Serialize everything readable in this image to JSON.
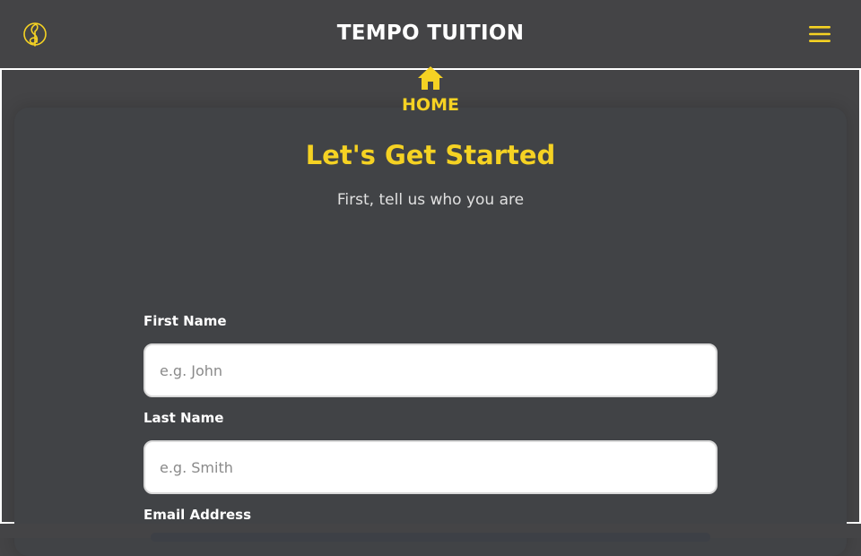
{
  "header": {
    "brand": "TEMPO TUITION",
    "logo_icon": "treble-clef-logo-icon",
    "menu_icon": "hamburger-menu-icon"
  },
  "colors": {
    "accent": "#f5d223",
    "background": "#444446",
    "card": "#414346"
  },
  "nav": {
    "home_label": "HOME",
    "home_icon": "home-icon"
  },
  "main": {
    "title": "Let's Get Started",
    "subtitle": "First, tell us who you are"
  },
  "form": {
    "first_name": {
      "label": "First Name",
      "placeholder": "e.g. John",
      "value": ""
    },
    "last_name": {
      "label": "Last Name",
      "placeholder": "e.g. Smith",
      "value": ""
    },
    "email": {
      "label": "Email Address"
    }
  }
}
